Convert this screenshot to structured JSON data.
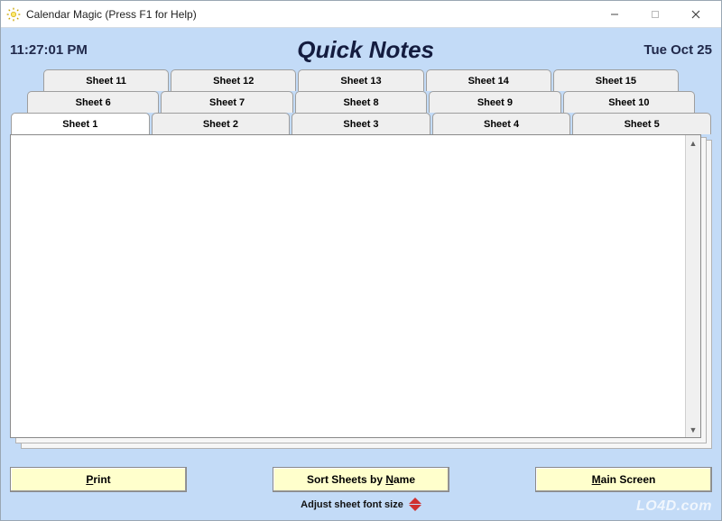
{
  "window": {
    "title": "Calendar Magic (Press F1 for Help)"
  },
  "header": {
    "time": "11:27:01 PM",
    "title": "Quick Notes",
    "date": "Tue Oct 25"
  },
  "tabs": {
    "row0": [
      "Sheet 11",
      "Sheet 12",
      "Sheet 13",
      "Sheet 14",
      "Sheet 15"
    ],
    "row1": [
      "Sheet 6",
      "Sheet 7",
      "Sheet 8",
      "Sheet 9",
      "Sheet 10"
    ],
    "row2": [
      "Sheet 1",
      "Sheet 2",
      "Sheet 3",
      "Sheet 4",
      "Sheet 5"
    ],
    "active": "Sheet 1"
  },
  "editor": {
    "content": ""
  },
  "buttons": {
    "print_pre": "",
    "print_u": "P",
    "print_post": "rint",
    "sort_pre": "Sort Sheets by ",
    "sort_u": "N",
    "sort_post": "ame",
    "main_pre": "",
    "main_u": "M",
    "main_post": "ain Screen"
  },
  "adjust": {
    "label": "Adjust sheet font size"
  },
  "watermark": "LO4D.com"
}
